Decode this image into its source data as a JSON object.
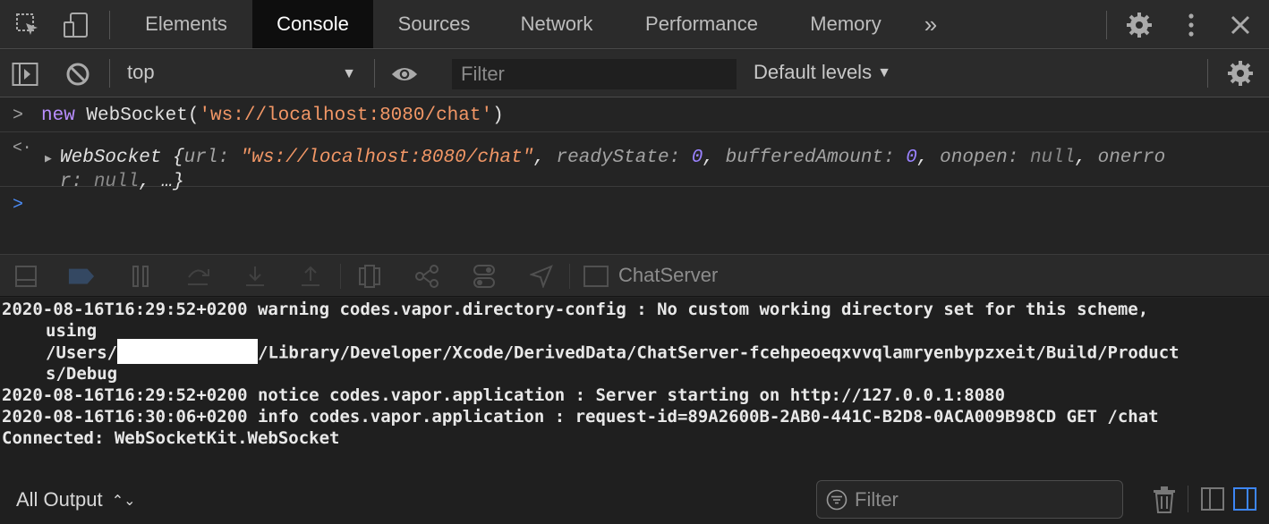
{
  "devtools": {
    "tabs": [
      "Elements",
      "Console",
      "Sources",
      "Network",
      "Performance",
      "Memory"
    ],
    "active_tab": "Console",
    "more_tabs": "»"
  },
  "console_toolbar": {
    "context": "top",
    "filter_placeholder": "Filter",
    "levels": "Default levels"
  },
  "console": {
    "input_keyword": "new",
    "input_class": " WebSocket(",
    "input_string": "'ws://localhost:8080/chat'",
    "input_close": ")",
    "result": {
      "class": "WebSocket",
      "open": " {",
      "url_key": "url",
      "url_value": "\"ws://localhost:8080/chat\"",
      "ready_key": "readyState",
      "ready_value": "0",
      "buffered_key": "bufferedAmount",
      "buffered_value": "0",
      "onopen_key": "onopen",
      "onopen_value": "null",
      "onerror_key_a": "onerro",
      "onerror_key_b": "r",
      "onerror_value": "null",
      "tail": "…}"
    }
  },
  "debug_bar": {
    "target": "ChatServer"
  },
  "output": {
    "lines": [
      "2020-08-16T16:29:52+0200 warning codes.vapor.directory-config : No custom working directory set for this scheme,",
      "using",
      "/Users/",
      "/Library/Developer/Xcode/DerivedData/ChatServer-fcehpeoeqxvvqlamryenbypzxeit/Build/Product",
      "s/Debug",
      "2020-08-16T16:29:52+0200 notice codes.vapor.application : Server starting on http://127.0.0.1:8080",
      "2020-08-16T16:30:06+0200 info codes.vapor.application : request-id=89A2600B-2AB0-441C-B2D8-0ACA009B98CD GET /chat",
      "Connected: WebSocketKit.WebSocket"
    ]
  },
  "bottom_bar": {
    "output_selector": "All Output",
    "filter_placeholder": "Filter"
  }
}
